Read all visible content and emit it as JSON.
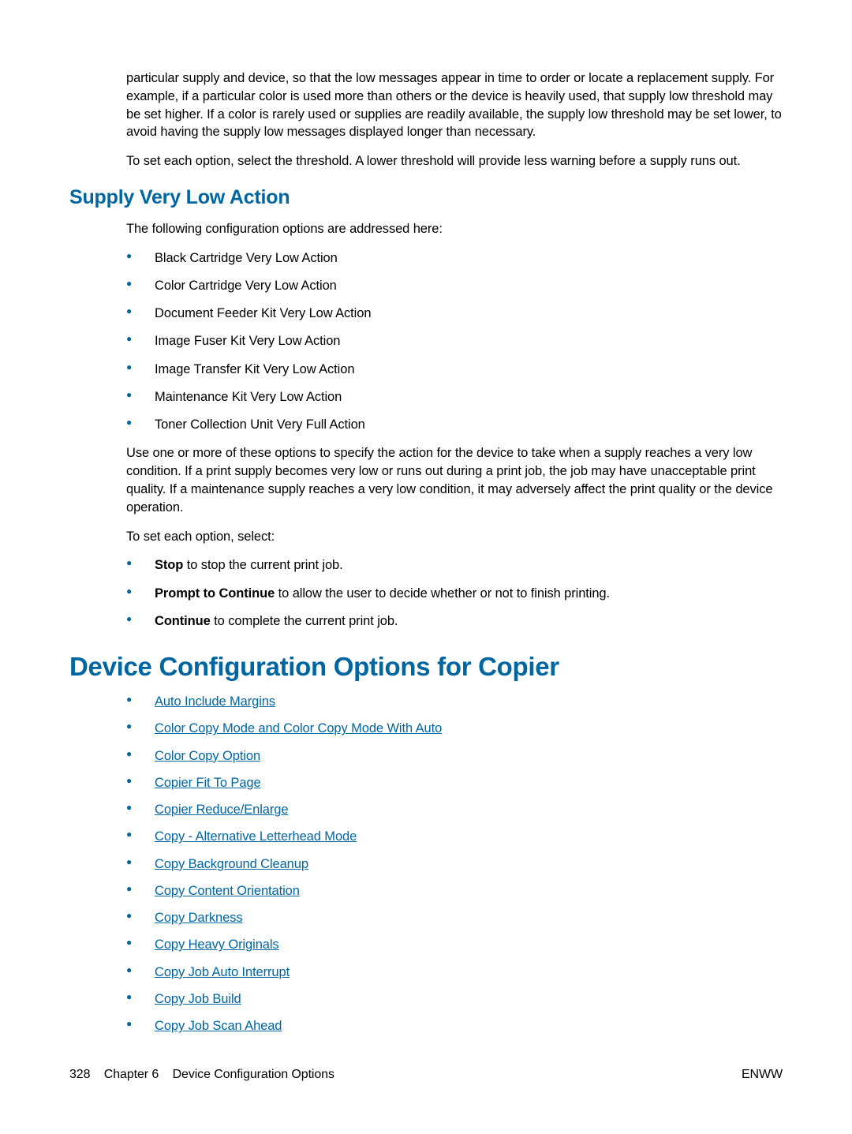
{
  "intro": {
    "p1": "particular supply and device, so that the low messages appear in time to order or locate a replacement supply. For example, if a particular color is used more than others or the device is heavily used, that supply low threshold may be set higher. If a color is rarely used or supplies are readily available, the supply low threshold may be set lower, to avoid having the supply low messages displayed longer than necessary.",
    "p2": "To set each option, select the threshold. A lower threshold will provide less warning before a supply runs out."
  },
  "section1": {
    "heading": "Supply Very Low Action",
    "lead": "The following configuration options are addressed here:",
    "options": [
      "Black Cartridge Very Low Action",
      "Color Cartridge Very Low Action",
      "Document Feeder Kit Very Low Action",
      "Image Fuser Kit Very Low Action",
      "Image Transfer Kit Very Low Action",
      "Maintenance Kit Very Low Action",
      "Toner Collection Unit Very Full Action"
    ],
    "p1": "Use one or more of these options to specify the action for the device to take when a supply reaches a very low condition. If a print supply becomes very low or runs out during a print job, the job may have unacceptable print quality. If a maintenance supply reaches a very low condition, it may adversely affect the print quality or the device operation.",
    "p2": "To set each option, select:",
    "actions": {
      "stop_label": "Stop",
      "stop_rest": " to stop the current print job.",
      "prompt_label": "Prompt to Continue",
      "prompt_rest": " to allow the user to decide whether or not to finish printing.",
      "continue_label": "Continue",
      "continue_rest": " to complete the current print job."
    }
  },
  "section2": {
    "heading": "Device Configuration Options for Copier",
    "links": [
      "Auto Include Margins",
      "Color Copy Mode and Color Copy Mode With Auto",
      "Color Copy Option",
      "Copier Fit To Page",
      "Copier Reduce/Enlarge",
      "Copy - Alternative Letterhead Mode",
      "Copy Background Cleanup",
      "Copy Content Orientation",
      "Copy Darkness",
      "Copy Heavy Originals",
      "Copy Job Auto Interrupt",
      "Copy Job Build",
      "Copy Job Scan Ahead"
    ]
  },
  "footer": {
    "page_number": "328",
    "chapter_prefix": "Chapter 6",
    "chapter_title": "Device Configuration Options",
    "right": "ENWW"
  }
}
